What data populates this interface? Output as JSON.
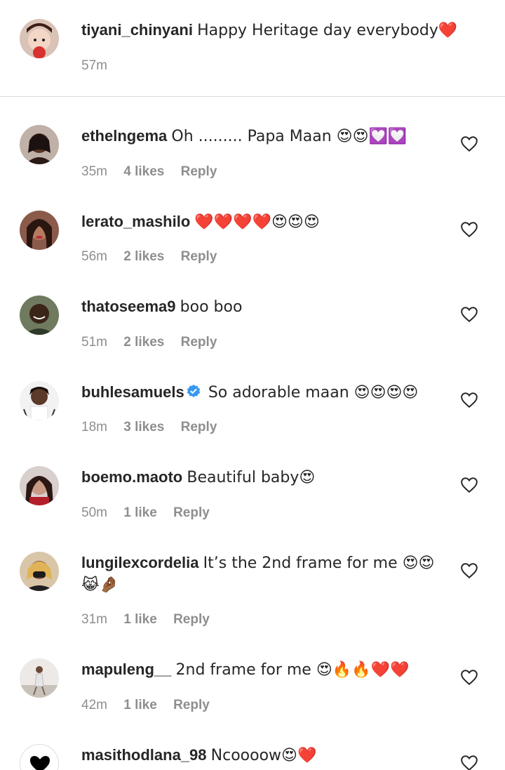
{
  "caption": {
    "username": "tiyani_chinyani",
    "text": "Happy Heritage day everybody❤️",
    "time": "57m"
  },
  "comments": [
    {
      "username": "ethelngema",
      "text": "Oh ......... Papa Maan 😍😍💟💟",
      "time": "35m",
      "likes": "4 likes",
      "reply": "Reply"
    },
    {
      "username": "lerato_mashilo",
      "text": "❤️❤️❤️❤️😍😍😍",
      "time": "56m",
      "likes": "2 likes",
      "reply": "Reply"
    },
    {
      "username": "thatoseema9",
      "text": "boo boo",
      "time": "51m",
      "likes": "2 likes",
      "reply": "Reply"
    },
    {
      "username": "buhlesamuels",
      "text": "So adorable maan 😍😍😍😍",
      "time": "18m",
      "likes": "3 likes",
      "reply": "Reply"
    },
    {
      "username": "boemo.maoto",
      "text": "Beautiful baby😍",
      "time": "50m",
      "likes": "1 like",
      "reply": "Reply"
    },
    {
      "username": "lungilexcordelia",
      "text": "It’s the 2nd frame for me 😍😍 😹🤌🏾",
      "time": "31m",
      "likes": "1 like",
      "reply": "Reply"
    },
    {
      "username": "mapuleng__",
      "text": "2nd frame for me 😍🔥🔥❤️❤️",
      "time": "42m",
      "likes": "1 like",
      "reply": "Reply"
    },
    {
      "username": "masithodlana_98",
      "text": "Ncoooow😍❤️",
      "time": "",
      "likes": "",
      "reply": ""
    }
  ],
  "colors": {
    "text": "#262626",
    "meta": "#8e8e8e",
    "verified": "#3897f0",
    "divider": "#dbdbdb"
  }
}
